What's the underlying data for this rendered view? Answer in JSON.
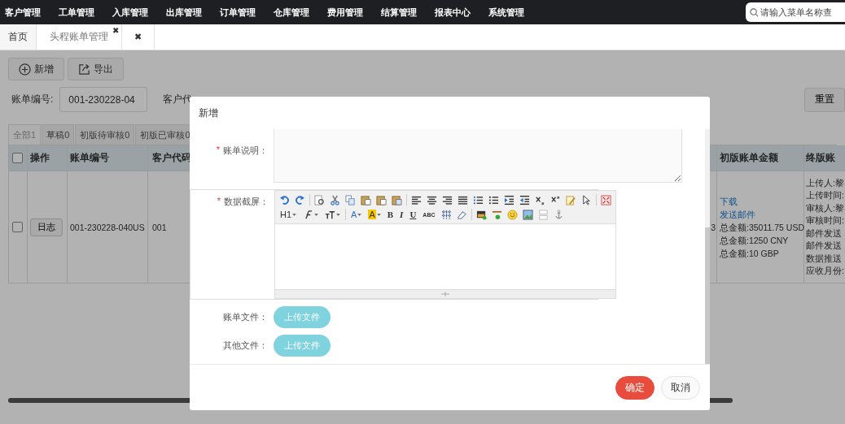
{
  "nav": {
    "items": [
      "客户管理",
      "工单管理",
      "入库管理",
      "出库管理",
      "订单管理",
      "仓库管理",
      "费用管理",
      "结算管理",
      "报表中心",
      "系统管理"
    ],
    "search": {
      "placeholder": "请输入菜单名称查"
    }
  },
  "tabs": [
    {
      "label": "首页",
      "selected": false
    },
    {
      "label": "头程账单管理",
      "selected": true,
      "close": "✖"
    }
  ],
  "close_all": "✖",
  "toolbar": [
    {
      "label": "新增"
    },
    {
      "label": "导出"
    }
  ],
  "filters": {
    "bill_no_label": "账单编号:",
    "bill_no_value": "001-230228-04",
    "customer_label": "客户代",
    "reset": "重置"
  },
  "status_tabs": [
    {
      "label": "全部1",
      "selected": true
    },
    {
      "label": "草稿0",
      "selected": false
    },
    {
      "label": "初版待审核0",
      "selected": false
    },
    {
      "label": "初版已审核0",
      "selected": false
    }
  ],
  "table": {
    "header_checked": false,
    "columns": [
      "操作",
      "账单编号",
      "客户代码",
      "初版账单金额",
      "终版账"
    ],
    "rows": [
      {
        "checked": false,
        "action": "日志",
        "bill_no": "001-230228-040US",
        "customer": "001",
        "column_4": "3",
        "links": [
          "下载",
          "发送邮件"
        ],
        "amounts": [
          "总金额:35011.75 USD",
          "总金额:1250 CNY",
          "总金额:10 GBP"
        ],
        "final": [
          "上传人:黎",
          "上传时间:",
          "审核人:黎",
          "审核时间:",
          "邮件发送",
          "邮件发送",
          "数据推送",
          "应收月份:"
        ]
      }
    ]
  },
  "modal": {
    "title": "新增",
    "fields": [
      {
        "kind": "textarea",
        "label": "账单说明：",
        "required_mark": "*"
      },
      {
        "kind": "editor",
        "label": "数据截屏：",
        "required_mark": "*",
        "toolbar_labels": [
          "H1",
          "A",
          "A",
          "B",
          "I",
          "U",
          "ABC"
        ]
      },
      {
        "kind": "upload",
        "label": "账单文件：",
        "button": "上传文件"
      },
      {
        "kind": "upload",
        "label": "其他文件：",
        "button": "上传文件"
      }
    ],
    "buttons": [
      {
        "label": "确定",
        "kind": "primary"
      },
      {
        "label": "取消",
        "kind": "default"
      }
    ]
  }
}
